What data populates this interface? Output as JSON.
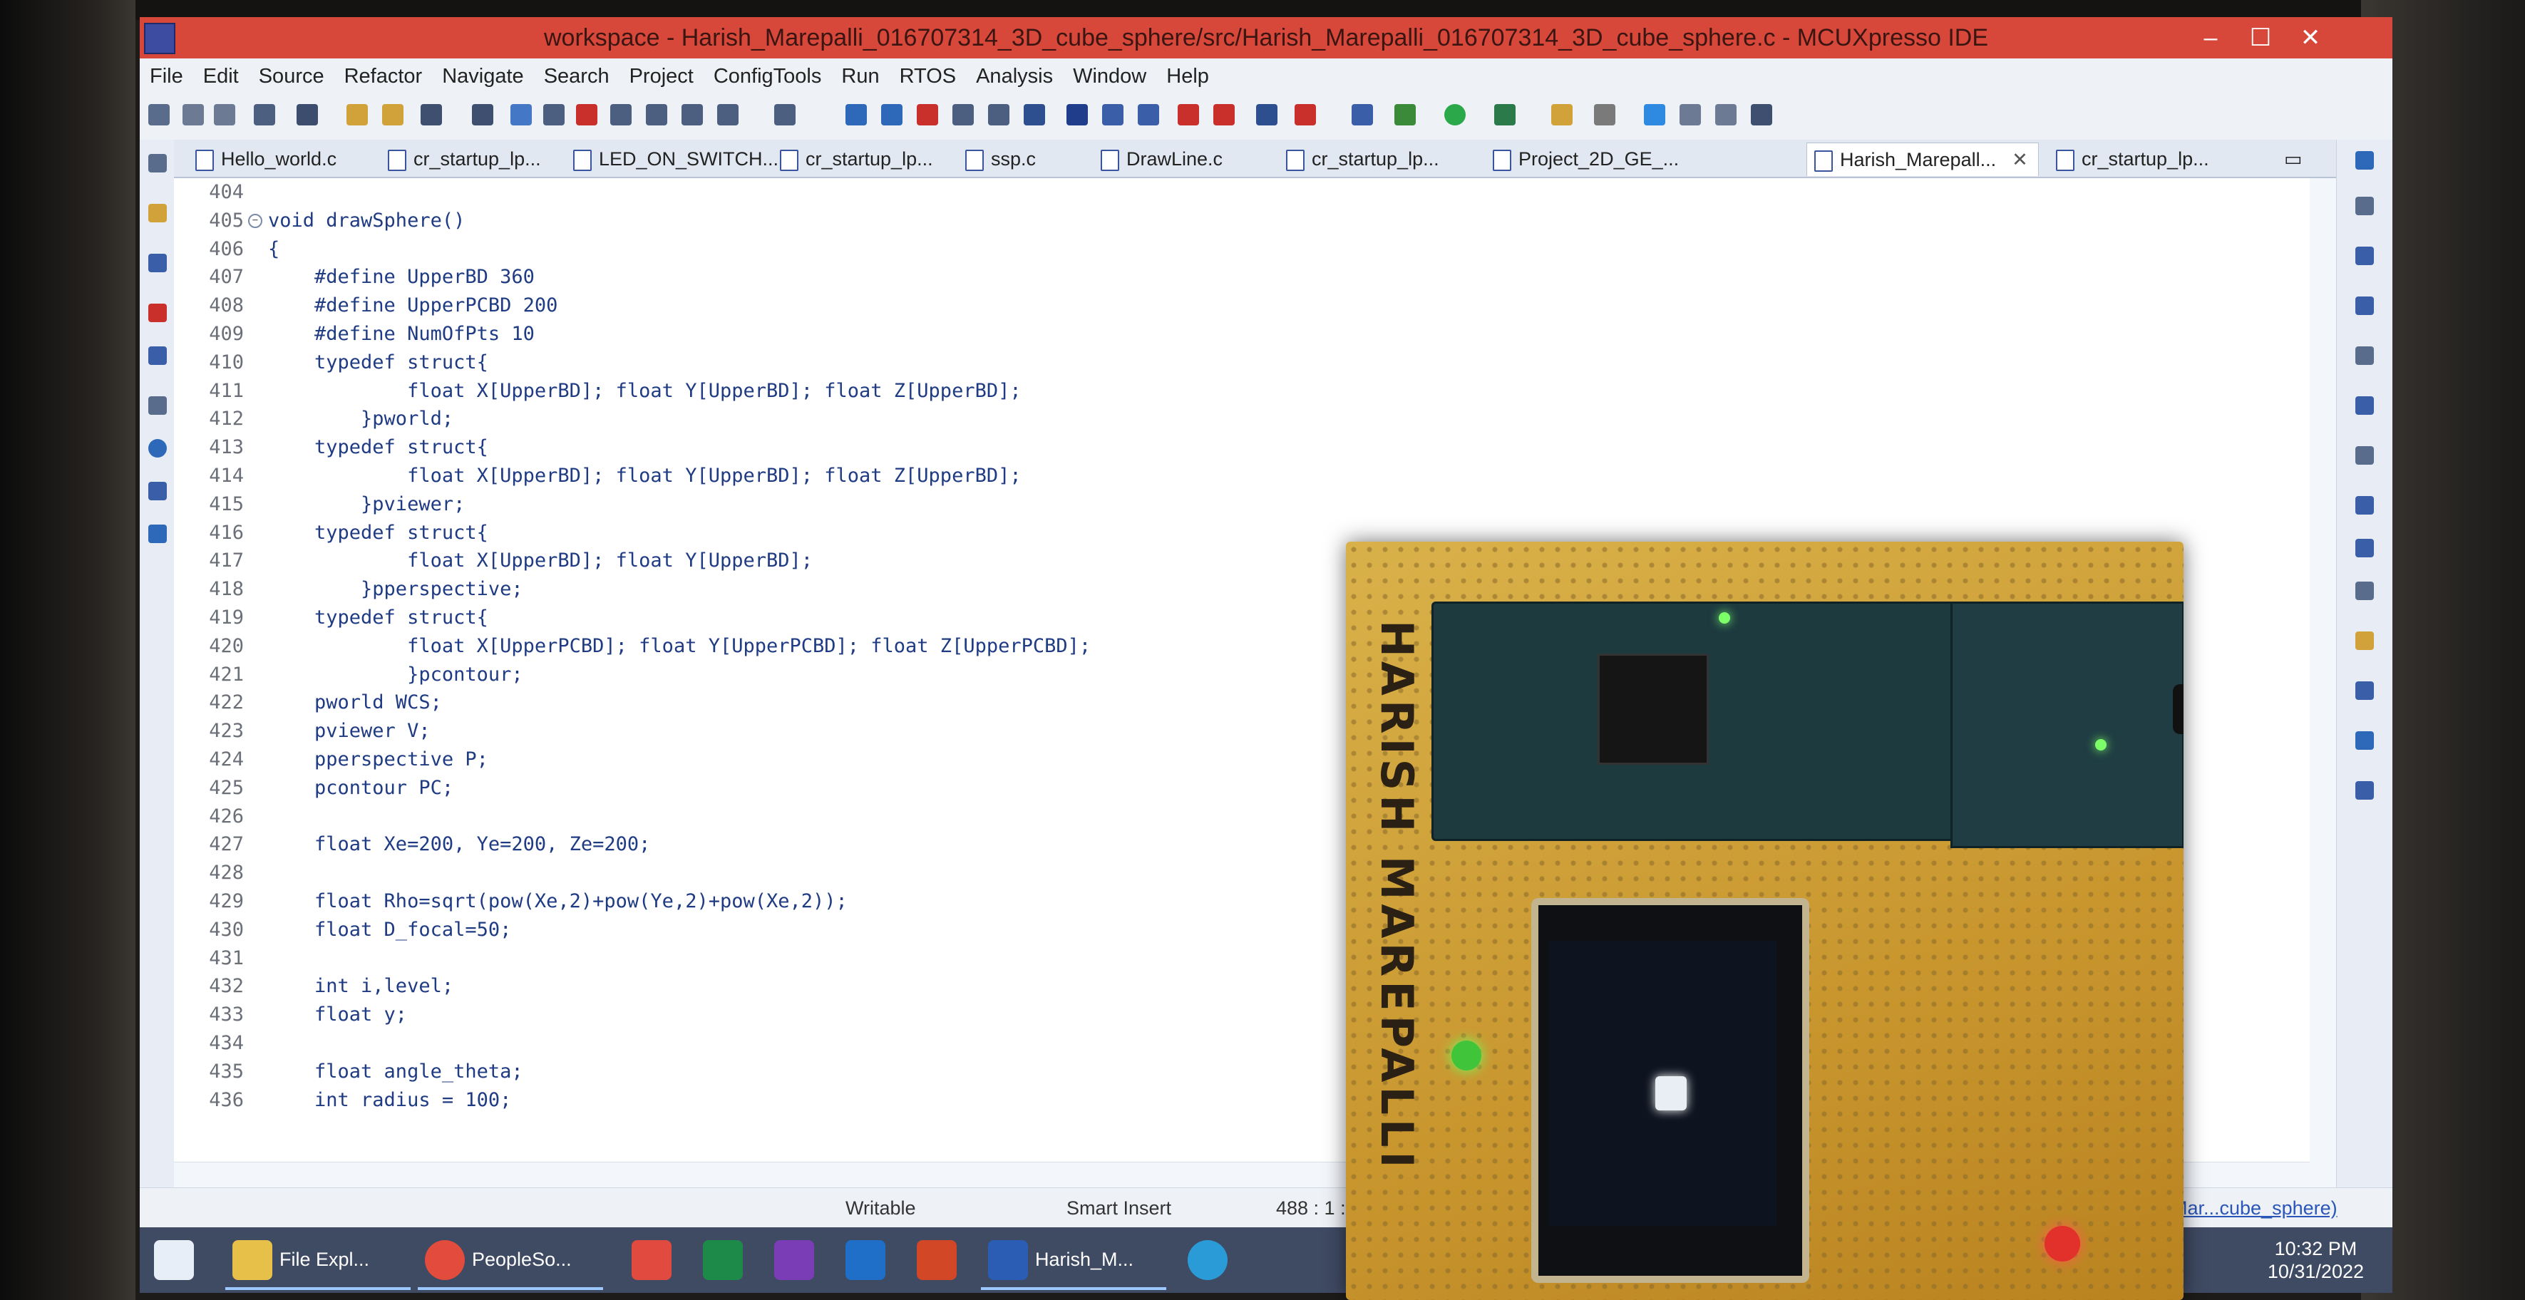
{
  "window": {
    "title": "workspace - Harish_Marepalli_016707314_3D_cube_sphere/src/Harish_Marepalli_016707314_3D_cube_sphere.c - MCUXpresso IDE",
    "minimize": "–",
    "maximize": "☐",
    "close": "✕"
  },
  "menu": [
    "File",
    "Edit",
    "Source",
    "Refactor",
    "Navigate",
    "Search",
    "Project",
    "ConfigTools",
    "Run",
    "RTOS",
    "Analysis",
    "Window",
    "Help"
  ],
  "tabs": [
    {
      "label": "Hello_world.c"
    },
    {
      "label": "cr_startup_lp..."
    },
    {
      "label": "LED_ON_SWITCH..."
    },
    {
      "label": "cr_startup_lp..."
    },
    {
      "label": "ssp.c"
    },
    {
      "label": "DrawLine.c"
    },
    {
      "label": "cr_startup_lp..."
    },
    {
      "label": "Project_2D_GE_..."
    },
    {
      "label": "Harish_Marepall..."
    },
    {
      "label": "cr_startup_lp..."
    }
  ],
  "code": [
    {
      "n": "404",
      "t": ""
    },
    {
      "n": "405",
      "t": "void drawSphere()"
    },
    {
      "n": "406",
      "t": "{"
    },
    {
      "n": "407",
      "t": "    #define UpperBD 360"
    },
    {
      "n": "408",
      "t": "    #define UpperPCBD 200"
    },
    {
      "n": "409",
      "t": "    #define NumOfPts 10"
    },
    {
      "n": "410",
      "t": "    typedef struct{"
    },
    {
      "n": "411",
      "t": "            float X[UpperBD]; float Y[UpperBD]; float Z[UpperBD];"
    },
    {
      "n": "412",
      "t": "        }pworld;"
    },
    {
      "n": "413",
      "t": "    typedef struct{"
    },
    {
      "n": "414",
      "t": "            float X[UpperBD]; float Y[UpperBD]; float Z[UpperBD];"
    },
    {
      "n": "415",
      "t": "        }pviewer;"
    },
    {
      "n": "416",
      "t": "    typedef struct{"
    },
    {
      "n": "417",
      "t": "            float X[UpperBD]; float Y[UpperBD];"
    },
    {
      "n": "418",
      "t": "        }pperspective;"
    },
    {
      "n": "419",
      "t": "    typedef struct{"
    },
    {
      "n": "420",
      "t": "            float X[UpperPCBD]; float Y[UpperPCBD]; float Z[UpperPCBD];"
    },
    {
      "n": "421",
      "t": "            }pcontour;"
    },
    {
      "n": "422",
      "t": "    pworld WCS;"
    },
    {
      "n": "423",
      "t": "    pviewer V;"
    },
    {
      "n": "424",
      "t": "    pperspective P;"
    },
    {
      "n": "425",
      "t": "    pcontour PC;"
    },
    {
      "n": "426",
      "t": ""
    },
    {
      "n": "427",
      "t": "    float Xe=200, Ye=200, Ze=200;"
    },
    {
      "n": "428",
      "t": ""
    },
    {
      "n": "429",
      "t": "    float Rho=sqrt(pow(Xe,2)+pow(Ye,2)+pow(Xe,2));"
    },
    {
      "n": "430",
      "t": "    float D_focal=50;"
    },
    {
      "n": "431",
      "t": ""
    },
    {
      "n": "432",
      "t": "    int i,level;"
    },
    {
      "n": "433",
      "t": "    float y;"
    },
    {
      "n": "434",
      "t": ""
    },
    {
      "n": "435",
      "t": "    float angle_theta;"
    },
    {
      "n": "436",
      "t": "    int radius = 100;"
    }
  ],
  "status": {
    "mode": "Writable",
    "insert": "Smart Insert",
    "position": "488 : 1 : 9",
    "project_link": "Mar...cube_sphere)"
  },
  "taskbar": {
    "items": [
      {
        "label": "File Expl..."
      },
      {
        "label": "PeopleSo..."
      },
      {
        "label": ""
      },
      {
        "label": ""
      },
      {
        "label": ""
      },
      {
        "label": ""
      },
      {
        "label": ""
      },
      {
        "label": "Harish_M..."
      }
    ],
    "time": "10:32 PM",
    "date": "10/31/2022"
  },
  "board": {
    "handwriting": "HARISH MAREPALLI"
  },
  "colors": {
    "titlebar": "#d8483a",
    "code_text": "#1f3b83",
    "accent": "#2a56b8"
  }
}
